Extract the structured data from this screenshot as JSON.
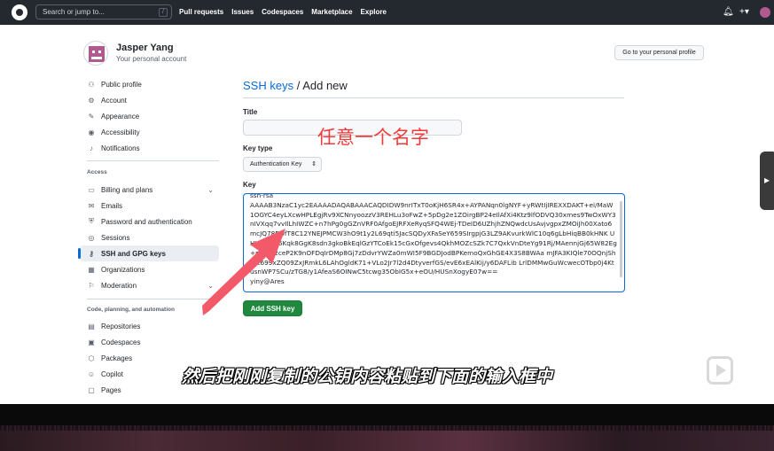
{
  "header": {
    "search_placeholder": "Search or jump to...",
    "search_key": "/",
    "nav": [
      "Pull requests",
      "Issues",
      "Codespaces",
      "Marketplace",
      "Explore"
    ],
    "icons": [
      "bell-icon",
      "plus-icon",
      "avatar-icon"
    ]
  },
  "profile": {
    "name": "Jasper Yang",
    "subtitle": "Your personal account",
    "go_button": "Go to your personal profile"
  },
  "sidebar": {
    "items_top": [
      {
        "label": "Public profile",
        "icon": "person-icon"
      },
      {
        "label": "Account",
        "icon": "gear-icon"
      },
      {
        "label": "Appearance",
        "icon": "paintbrush-icon"
      },
      {
        "label": "Accessibility",
        "icon": "accessibility-icon"
      },
      {
        "label": "Notifications",
        "icon": "bell-icon"
      }
    ],
    "access_heading": "Access",
    "items_access": [
      {
        "label": "Billing and plans",
        "icon": "credit-card-icon"
      },
      {
        "label": "Emails",
        "icon": "mail-icon"
      },
      {
        "label": "Password and authentication",
        "icon": "shield-icon"
      },
      {
        "label": "Sessions",
        "icon": "broadcast-icon"
      },
      {
        "label": "SSH and GPG keys",
        "icon": "key-icon"
      },
      {
        "label": "Organizations",
        "icon": "organization-icon"
      },
      {
        "label": "Moderation",
        "icon": "report-icon"
      }
    ],
    "code_heading": "Code, planning, and automation",
    "items_code": [
      {
        "label": "Repositories",
        "icon": "repo-icon"
      },
      {
        "label": "Codespaces",
        "icon": "codespaces-icon"
      },
      {
        "label": "Packages",
        "icon": "package-icon"
      },
      {
        "label": "Copilot",
        "icon": "copilot-icon"
      },
      {
        "label": "Pages",
        "icon": "browser-icon"
      }
    ]
  },
  "main": {
    "breadcrumb_link": "SSH keys",
    "breadcrumb_rest": " / Add new",
    "title_label": "Title",
    "key_type_label": "Key type",
    "key_type_value": "Authentication Key",
    "key_label": "Key",
    "key_value": "ssh-rsa\nAAAAB3NzaC1yc2EAAAADAQABAAACAQDIDW9nrITxT0oKjH6SR4x+AYPANqn0lgNYF+yRWtIjIREXXDAKT+ei/MaW1OGYC4eyLXcwHPLEgjRv9XCNnyoozzV3REHLu3oFwZ+5pDg2e1ZOirgBP24eIlAfXi4Ktz9lfODVQ30xmes9TwOxWY3nIVXqq7vvIlLhIWZC+n7hPg0gGZnVRF0AfgoEJRFXeRyqSFQ4WEj-TDeID6UZhjhZNQwdcUsAvjvgpxZMOiJh00Xato6mcJQ78BOfT8C12YNEJPMCW3hO9t1y2L69qti5JacSQDyXFaSeY659SIrgpjG3LZ9AKvurkWlC10q6gLbHiqBB0kHNK UHW7CxR6Kqk8GgK8sdn3gkoBkEqlGzYTCoEk15cGxOfgevs4QkhMOZcSZk7C7QxkVnDteYg91Rj/MAennjGj65W82Eg+rP3PS2ceP2K9nOFDqIrDMp8Gj7zDdvrYWZa0mWI5F9BGDJodBPKemoQxGhGE4X3S8BWAa mJFA3KIQle70OQnjShhct699xZQ09ZxJRmkL6LAhOgldK71+VLo2Jr7l2d4DtyverfGS/evE6xEAlKij/y6DAFLib LrlDMMwGuWcwecOTbp0j4KtusnWP7SCu/zTG8/y1AfeaS6OINwC5tcwg35ObIG5x+eOU/HUSnXogyE07w==\nyiny@Ares",
    "add_button": "Add SSH key"
  },
  "overlay": {
    "annotation": "任意一个名字",
    "subtitle": "然后把刚刚复制的公钥内容粘贴到下面的输入框中",
    "annotation_color": "#f03a3a",
    "arrow_color": "#f25a6a"
  }
}
